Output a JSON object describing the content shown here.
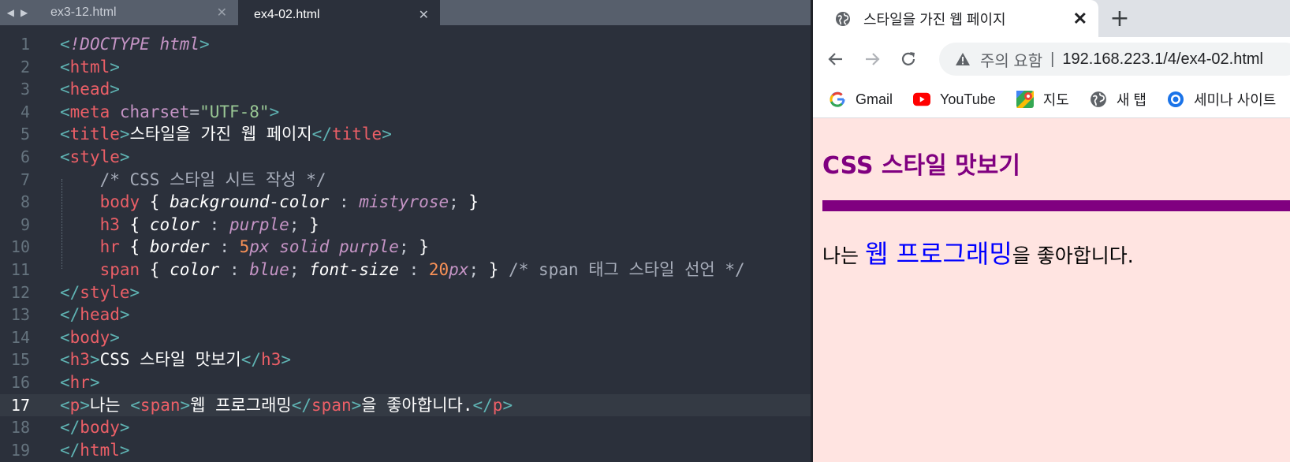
{
  "editor": {
    "tabs": [
      {
        "label": "ex3-12.html",
        "active": false
      },
      {
        "label": "ex4-02.html",
        "active": true
      }
    ],
    "active_line": 17,
    "lines": [
      {
        "n": "1",
        "tokens": [
          [
            "p",
            "<"
          ],
          [
            "it",
            "!DOCTYPE html"
          ],
          [
            "p",
            ">"
          ]
        ]
      },
      {
        "n": "2",
        "tokens": [
          [
            "p",
            "<"
          ],
          [
            "tag",
            "html"
          ],
          [
            "p",
            ">"
          ]
        ]
      },
      {
        "n": "3",
        "tokens": [
          [
            "p",
            "<"
          ],
          [
            "tag",
            "head"
          ],
          [
            "p",
            ">"
          ]
        ]
      },
      {
        "n": "4",
        "tokens": [
          [
            "p",
            "<"
          ],
          [
            "tag",
            "meta"
          ],
          [
            "txt",
            " "
          ],
          [
            "attr",
            "charset"
          ],
          [
            "pun",
            "="
          ],
          [
            "str",
            "\"UTF-8\""
          ],
          [
            "p",
            ">"
          ]
        ]
      },
      {
        "n": "5",
        "tokens": [
          [
            "p",
            "<"
          ],
          [
            "tag",
            "title"
          ],
          [
            "p",
            ">"
          ],
          [
            "txt",
            "스타일을 가진 웹 페이지"
          ],
          [
            "p",
            "</"
          ],
          [
            "tag",
            "title"
          ],
          [
            "p",
            ">"
          ]
        ]
      },
      {
        "n": "6",
        "tokens": [
          [
            "p",
            "<"
          ],
          [
            "tag",
            "style"
          ],
          [
            "p",
            ">"
          ]
        ]
      },
      {
        "n": "7",
        "tokens": [
          [
            "txt",
            "    "
          ],
          [
            "com",
            "/* CSS 스타일 시트 작성 */"
          ]
        ]
      },
      {
        "n": "8",
        "tokens": [
          [
            "txt",
            "    "
          ],
          [
            "sel",
            "body"
          ],
          [
            "br",
            " { "
          ],
          [
            "prop",
            "background-color"
          ],
          [
            "pun",
            " : "
          ],
          [
            "val",
            "mistyrose"
          ],
          [
            "pun",
            ";"
          ],
          [
            "br",
            " }"
          ]
        ]
      },
      {
        "n": "9",
        "tokens": [
          [
            "txt",
            "    "
          ],
          [
            "sel",
            "h3"
          ],
          [
            "br",
            " { "
          ],
          [
            "prop",
            "color"
          ],
          [
            "pun",
            " : "
          ],
          [
            "val",
            "purple"
          ],
          [
            "pun",
            ";"
          ],
          [
            "br",
            " }"
          ]
        ]
      },
      {
        "n": "10",
        "tokens": [
          [
            "txt",
            "    "
          ],
          [
            "sel",
            "hr"
          ],
          [
            "br",
            " { "
          ],
          [
            "prop",
            "border"
          ],
          [
            "pun",
            " : "
          ],
          [
            "num",
            "5"
          ],
          [
            "unit",
            "px"
          ],
          [
            "txt",
            " "
          ],
          [
            "val",
            "solid purple"
          ],
          [
            "pun",
            ";"
          ],
          [
            "br",
            " }"
          ]
        ]
      },
      {
        "n": "11",
        "tokens": [
          [
            "txt",
            "    "
          ],
          [
            "sel",
            "span"
          ],
          [
            "br",
            " { "
          ],
          [
            "prop",
            "color"
          ],
          [
            "pun",
            " : "
          ],
          [
            "val",
            "blue"
          ],
          [
            "pun",
            "; "
          ],
          [
            "prop",
            "font-size"
          ],
          [
            "pun",
            " : "
          ],
          [
            "num",
            "20"
          ],
          [
            "unit",
            "px"
          ],
          [
            "pun",
            ";"
          ],
          [
            "br",
            " } "
          ],
          [
            "com",
            "/* span 태그 스타일 선언 */"
          ]
        ]
      },
      {
        "n": "12",
        "tokens": [
          [
            "p",
            "</"
          ],
          [
            "tag",
            "style"
          ],
          [
            "p",
            ">"
          ]
        ]
      },
      {
        "n": "13",
        "tokens": [
          [
            "p",
            "</"
          ],
          [
            "tag",
            "head"
          ],
          [
            "p",
            ">"
          ]
        ]
      },
      {
        "n": "14",
        "tokens": [
          [
            "p",
            "<"
          ],
          [
            "tag",
            "body"
          ],
          [
            "p",
            ">"
          ]
        ]
      },
      {
        "n": "15",
        "tokens": [
          [
            "p",
            "<"
          ],
          [
            "tag",
            "h3"
          ],
          [
            "p",
            ">"
          ],
          [
            "txt",
            "CSS 스타일 맛보기"
          ],
          [
            "p",
            "</"
          ],
          [
            "tag",
            "h3"
          ],
          [
            "p",
            ">"
          ]
        ]
      },
      {
        "n": "16",
        "tokens": [
          [
            "p",
            "<"
          ],
          [
            "tag",
            "hr"
          ],
          [
            "p",
            ">"
          ]
        ]
      },
      {
        "n": "17",
        "tokens": [
          [
            "p",
            "<"
          ],
          [
            "tag",
            "p"
          ],
          [
            "p",
            ">"
          ],
          [
            "txt",
            "나는 "
          ],
          [
            "p",
            "<"
          ],
          [
            "tag",
            "span"
          ],
          [
            "p",
            ">"
          ],
          [
            "txt",
            "웹 프로그래밍"
          ],
          [
            "p",
            "</"
          ],
          [
            "tag",
            "span"
          ],
          [
            "p",
            ">"
          ],
          [
            "txt",
            "을 좋아합니다."
          ],
          [
            "p",
            "</"
          ],
          [
            "tag",
            "p"
          ],
          [
            "p",
            ">"
          ]
        ]
      },
      {
        "n": "18",
        "tokens": [
          [
            "p",
            "</"
          ],
          [
            "tag",
            "body"
          ],
          [
            "p",
            ">"
          ]
        ]
      },
      {
        "n": "19",
        "tokens": [
          [
            "p",
            "</"
          ],
          [
            "tag",
            "html"
          ],
          [
            "p",
            ">"
          ]
        ]
      }
    ]
  },
  "browser": {
    "tab_title": "스타일을 가진 웹 페이지",
    "close_glyph": "✕",
    "new_tab_glyph": "+",
    "security_label": "주의 요함",
    "separator": "|",
    "url": "192.168.223.1/4/ex4-02.html",
    "bookmarks": [
      {
        "label": "Gmail",
        "icon": "google-icon"
      },
      {
        "label": "YouTube",
        "icon": "youtube-icon"
      },
      {
        "label": "지도",
        "icon": "maps-icon"
      },
      {
        "label": "새 탭",
        "icon": "globe-icon"
      },
      {
        "label": "세미나 사이트",
        "icon": "chrome-icon"
      }
    ],
    "page": {
      "heading": "CSS 스타일 맛보기",
      "para_before": "나는 ",
      "para_span": "웹 프로그래밍",
      "para_after": "을 좋아합니다."
    },
    "colors": {
      "page_bg": "#ffe4e1",
      "heading": "#800080",
      "hr": "#800080",
      "span": "#0000ff"
    }
  }
}
